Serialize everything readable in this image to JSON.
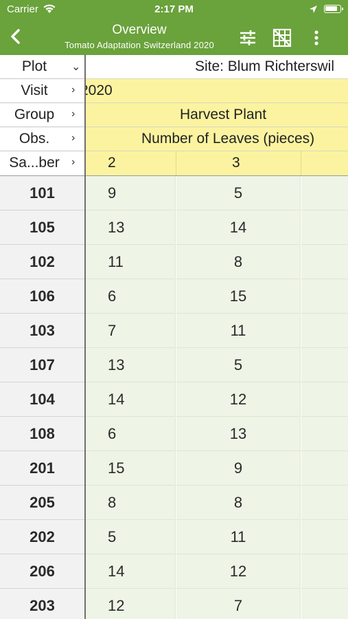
{
  "status_bar": {
    "carrier": "Carrier",
    "time": "2:17 PM",
    "battery_level": 0.9
  },
  "nav": {
    "title": "Overview",
    "subtitle": "Tomato Adaptation Switzerland 2020"
  },
  "header": {
    "labels": {
      "plot": "Plot",
      "visit": "Visit",
      "group": "Group",
      "obs": "Obs.",
      "sample": "Sa...ber"
    },
    "site": "Site: Blum Richterswil",
    "visit_value": "2020",
    "group_value": "Harvest Plant",
    "obs_value": "Number of Leaves (pieces)",
    "sample_col1": "2",
    "sample_col2": "3"
  },
  "rows": [
    {
      "plot": "101",
      "v1": "9",
      "v2": "5"
    },
    {
      "plot": "105",
      "v1": "13",
      "v2": "14"
    },
    {
      "plot": "102",
      "v1": "11",
      "v2": "8"
    },
    {
      "plot": "106",
      "v1": "6",
      "v2": "15"
    },
    {
      "plot": "103",
      "v1": "7",
      "v2": "11"
    },
    {
      "plot": "107",
      "v1": "13",
      "v2": "5"
    },
    {
      "plot": "104",
      "v1": "14",
      "v2": "12"
    },
    {
      "plot": "108",
      "v1": "6",
      "v2": "13"
    },
    {
      "plot": "201",
      "v1": "15",
      "v2": "9"
    },
    {
      "plot": "205",
      "v1": "8",
      "v2": "8"
    },
    {
      "plot": "202",
      "v1": "5",
      "v2": "11"
    },
    {
      "plot": "206",
      "v1": "14",
      "v2": "12"
    },
    {
      "plot": "203",
      "v1": "12",
      "v2": "7"
    }
  ],
  "colors": {
    "brand_green": "#6aa23b",
    "header_yellow": "#fbf3a0",
    "cell_green": "#eef4e6",
    "plot_gray": "#f2f2f2"
  }
}
